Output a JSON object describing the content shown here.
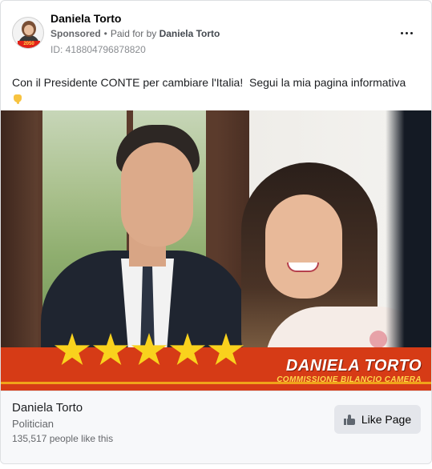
{
  "header": {
    "page_name": "Daniela Torto",
    "sponsored": "Sponsored",
    "separator": "•",
    "paid_for_by_prefix": "Paid for by",
    "paid_for_by_name": "Daniela Torto",
    "ad_id": "ID: 418804796878820",
    "avatar_badge": "2050"
  },
  "post": {
    "text": "Con il Presidente CONTE per cambiare l'Italia! ‪ ‬Segui la mia pagina informativa"
  },
  "image": {
    "banner_name": "DANIELA TORTO",
    "banner_subtitle": "COMMISSIONE BILANCIO CAMERA",
    "star_count": 5
  },
  "footer": {
    "page_name": "Daniela Torto",
    "category": "Politician",
    "likes": "135,517 people like this",
    "like_button_label": "Like Page"
  },
  "colors": {
    "banner_red": "#d63b16",
    "star_yellow": "#f9d21d",
    "subtitle_yellow": "#ffd84a"
  },
  "icons": [
    "more-options-icon",
    "pointing-down-emoji",
    "thumbs-up-icon"
  ]
}
